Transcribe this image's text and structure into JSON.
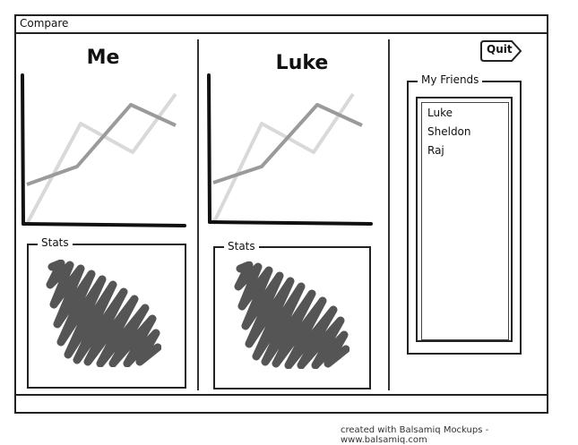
{
  "window": {
    "title": "Compare"
  },
  "me_panel": {
    "name": "Me",
    "stats_label": "Stats"
  },
  "luke_panel": {
    "name": "Luke",
    "stats_label": "Stats"
  },
  "sidebar": {
    "quit_label": "Quit",
    "friends_title": "My Friends",
    "friends": [
      "Luke",
      "Sheldon",
      "Raj"
    ]
  },
  "footer": "created with Balsamiq Mockups - www.balsamiq.com",
  "colors": {
    "line_dark": "#9a9a9a",
    "line_light": "#d9d9d9",
    "scribble": "#555555",
    "axis": "#111111"
  },
  "icons": {
    "quit": "quit-icon"
  }
}
